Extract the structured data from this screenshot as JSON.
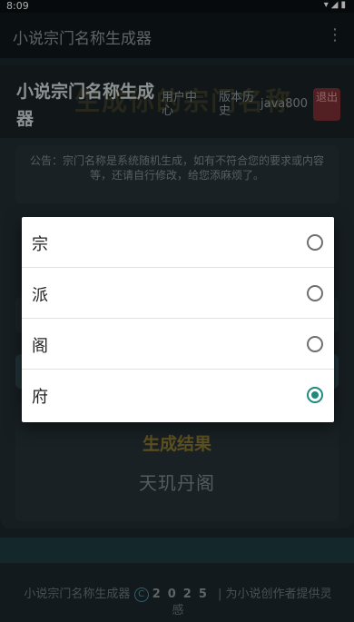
{
  "status_bar": {
    "time": "8:09"
  },
  "app_bar": {
    "title": "小说宗门名称生成器",
    "menu_icon": "more-vert-icon"
  },
  "header": {
    "brand": "小说宗门名称生成器",
    "bg_title": "生成你的宗门名称",
    "nav_user_center": "用户中心",
    "nav_history": "版本历史",
    "username": "java800",
    "logout": "退出"
  },
  "notice": "公告：宗门名称是系统随机生成，如有不符合您的要求或内容等，还请自行修改，给您添麻烦了。",
  "result": {
    "label": "生成结果",
    "name": "天玑丹阁"
  },
  "footer": {
    "app_name": "小说宗门名称生成器",
    "year": "2025",
    "tagline": "| 为小说创作者提供灵感"
  },
  "dialog": {
    "options": [
      {
        "label": "宗",
        "selected": false
      },
      {
        "label": "派",
        "selected": false
      },
      {
        "label": "阁",
        "selected": false
      },
      {
        "label": "府",
        "selected": true
      }
    ]
  },
  "colors": {
    "accent": "#1e8a7e",
    "logout_bg": "#7a3034",
    "result_label": "#8a7630"
  }
}
